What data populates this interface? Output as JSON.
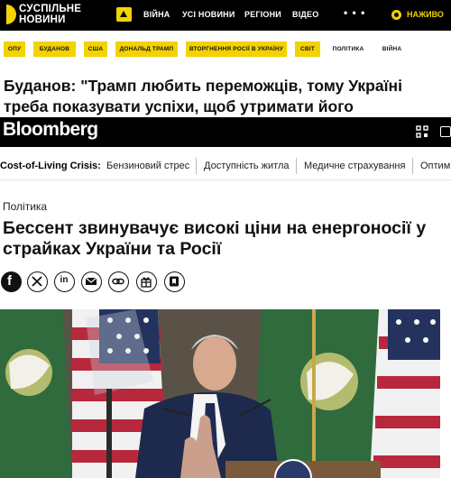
{
  "suspilne": {
    "logo_line1": "СУСПІЛЬНЕ",
    "logo_line2": "НОВИНИ",
    "nav": [
      "ВІЙНА",
      "УСІ НОВИНИ",
      "РЕГІОНИ",
      "ВІДЕО"
    ],
    "more": "• • •",
    "live": "НАЖИВО",
    "tags": [
      "ОПУ",
      "БУДАНОВ",
      "США",
      "ДОНАЛЬД ТРАМП",
      "ВТОРГНЕННЯ РОСІЇ В УКРАЇНУ",
      "СВІТ",
      "ПОЛІТИКА",
      "ВІЙНА"
    ],
    "headline": "Буданов: \"Трамп любить переможців, тому Україні треба показувати успіхи, щоб утримати його прихильність\"",
    "accent": "#f2d300"
  },
  "bloomberg": {
    "logo": "Bloomberg",
    "topics": [
      "Cost-of-Living Crisis:",
      "Бензиновий стрес",
      "Доступність житла",
      "Медичне страхування",
      "Оптим"
    ],
    "section": "Політика",
    "headline": "Бессент звинувачує високі ціни на енергоносії у страйках України та Росії",
    "share_icons": [
      "facebook-icon",
      "x-icon",
      "linkedin-icon",
      "email-icon",
      "link-icon",
      "gift-icon",
      "bookmark-icon"
    ]
  }
}
